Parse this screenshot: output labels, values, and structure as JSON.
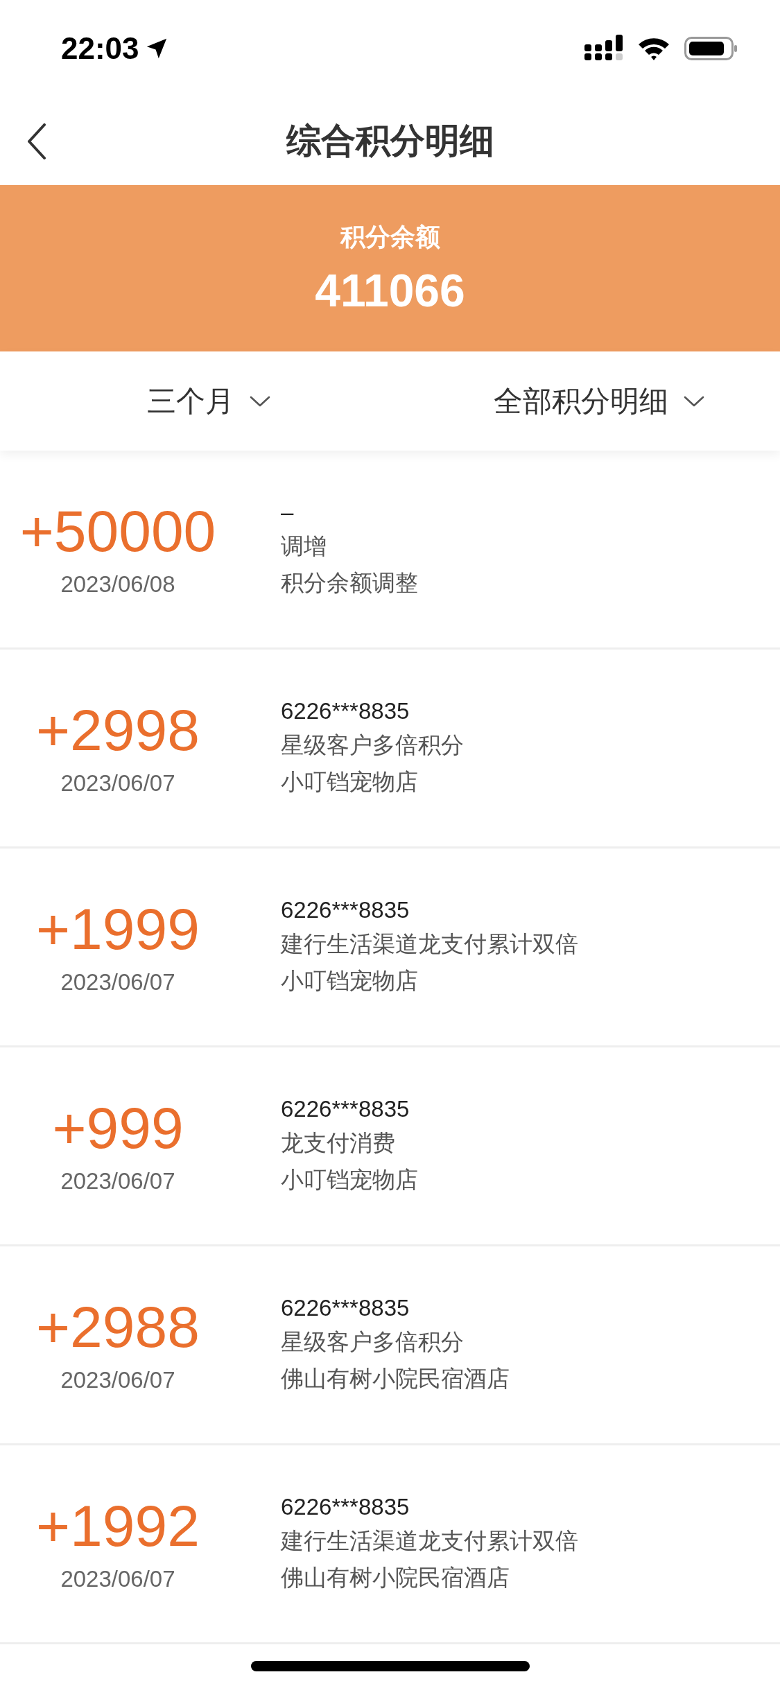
{
  "status_bar": {
    "time": "22:03"
  },
  "nav": {
    "title": "综合积分明细"
  },
  "balance": {
    "label": "积分余额",
    "value": "411066"
  },
  "filters": [
    {
      "label": "三个月"
    },
    {
      "label": "全部积分明细"
    }
  ],
  "records": [
    {
      "amount": "+50000",
      "date": "2023/06/08",
      "card": "–",
      "type": "调增",
      "merchant": "积分余额调整"
    },
    {
      "amount": "+2998",
      "date": "2023/06/07",
      "card": "6226***8835",
      "type": "星级客户多倍积分",
      "merchant": "小叮铛宠物店"
    },
    {
      "amount": "+1999",
      "date": "2023/06/07",
      "card": "6226***8835",
      "type": "建行生活渠道龙支付累计双倍",
      "merchant": "小叮铛宠物店"
    },
    {
      "amount": "+999",
      "date": "2023/06/07",
      "card": "6226***8835",
      "type": "龙支付消费",
      "merchant": "小叮铛宠物店"
    },
    {
      "amount": "+2988",
      "date": "2023/06/07",
      "card": "6226***8835",
      "type": "星级客户多倍积分",
      "merchant": "佛山有树小院民宿酒店"
    },
    {
      "amount": "+1992",
      "date": "2023/06/07",
      "card": "6226***8835",
      "type": "建行生活渠道龙支付累计双倍",
      "merchant": "佛山有树小院民宿酒店"
    }
  ]
}
